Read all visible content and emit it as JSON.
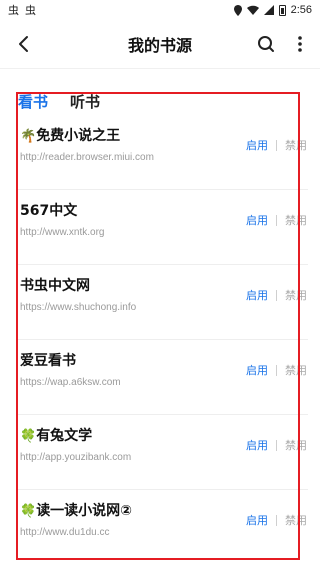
{
  "status_bar": {
    "left_icons": [
      "虫",
      "虫"
    ],
    "time": "2:56"
  },
  "app_bar": {
    "title": "我的书源"
  },
  "tabs": [
    {
      "label": "看书",
      "active": true
    },
    {
      "label": "听书",
      "active": false
    }
  ],
  "sources": [
    {
      "icon": "🌴",
      "title": "免费小说之王",
      "url": "http://reader.browser.miui.com"
    },
    {
      "icon": "",
      "title": "567中文",
      "url": "http://www.xntk.org"
    },
    {
      "icon": "",
      "title": "书虫中文网",
      "url": "https://www.shuchong.info"
    },
    {
      "icon": "",
      "title": "爱豆看书",
      "url": "https://wap.a6ksw.com"
    },
    {
      "icon": "🍀",
      "title": "有兔文学",
      "url": "http://app.youzibank.com"
    },
    {
      "icon": "🍀",
      "title": "读一读小说网②",
      "url": "http://www.du1du.cc"
    }
  ],
  "actions": {
    "enable_label": "启用",
    "disable_label": "禁用"
  },
  "colors": {
    "accent": "#1a73e8",
    "highlight_border": "#e51c23",
    "muted": "#9a9a9a"
  }
}
